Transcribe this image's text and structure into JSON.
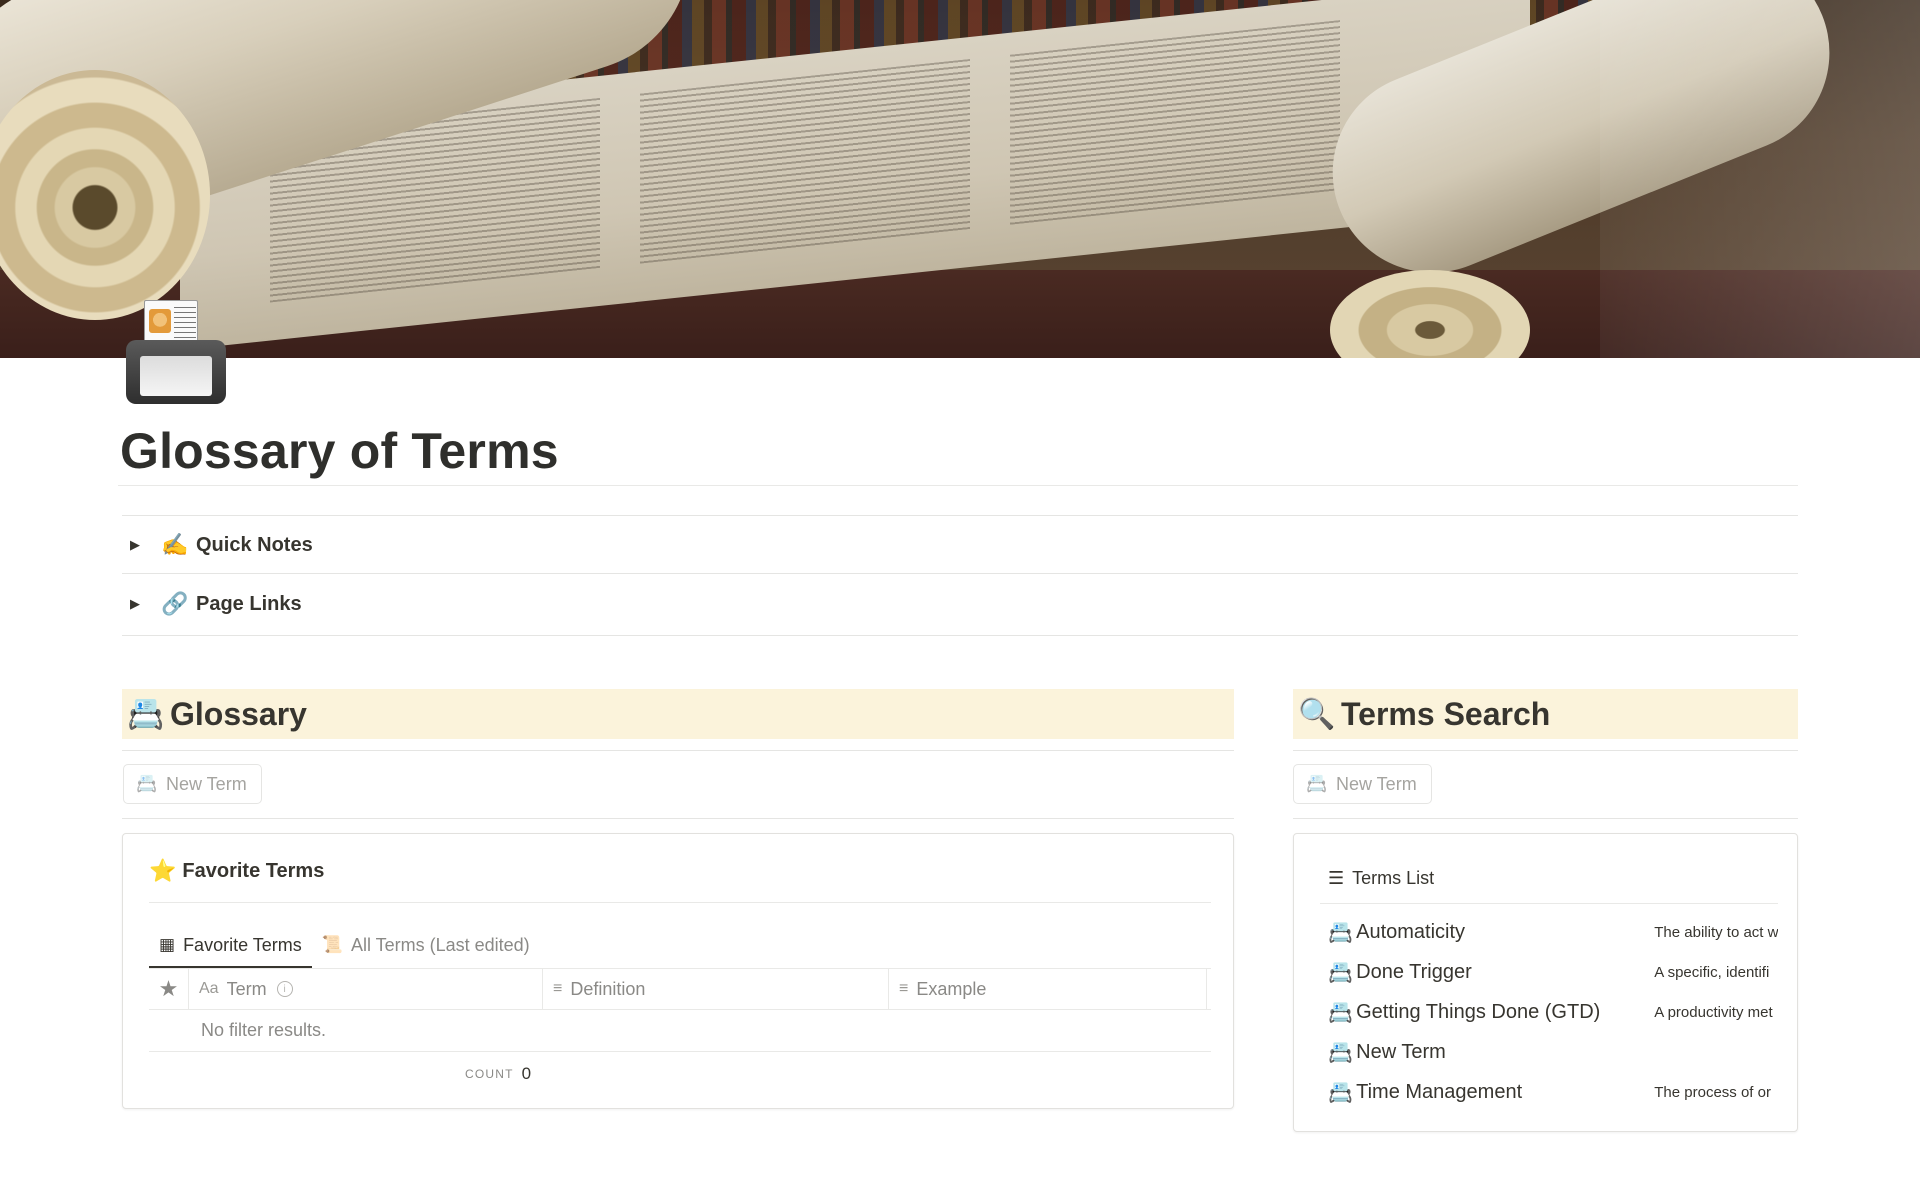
{
  "page": {
    "title": "Glossary of Terms",
    "icon": "card-printer-icon"
  },
  "toggles": [
    {
      "emoji": "✍️",
      "label": "Quick Notes"
    },
    {
      "emoji": "🔗",
      "label": "Page Links"
    }
  ],
  "glossary": {
    "header_emoji": "📇",
    "header": "Glossary",
    "new_button": "New Term",
    "view_title_emoji": "⭐",
    "view_title": "Favorite Terms",
    "tabs": [
      {
        "icon": "table-icon",
        "label": "Favorite Terms",
        "active": true
      },
      {
        "icon": "scroll-icon",
        "label": "All Terms (Last edited)",
        "active": false
      }
    ],
    "columns": [
      {
        "icon": "Aa",
        "label": "Term"
      },
      {
        "icon": "≡",
        "label": "Definition"
      },
      {
        "icon": "≡",
        "label": "Example"
      }
    ],
    "empty_text": "No filter results.",
    "count_label": "COUNT",
    "count_value": "0"
  },
  "search": {
    "header_emoji": "🔍",
    "header": "Terms Search",
    "new_button": "New Term",
    "list_title": "Terms List",
    "rows": [
      {
        "name": "Automaticity",
        "definition": "The ability to act w"
      },
      {
        "name": "Done Trigger",
        "definition": "A specific, identifi"
      },
      {
        "name": "Getting Things Done (GTD)",
        "definition": "A productivity met"
      },
      {
        "name": "New Term",
        "definition": ""
      },
      {
        "name": "Time Management",
        "definition": "The process of or"
      }
    ]
  },
  "colors": {
    "header_bg": "#fbf3db",
    "text": "#37352f",
    "muted": "#8a8986"
  }
}
